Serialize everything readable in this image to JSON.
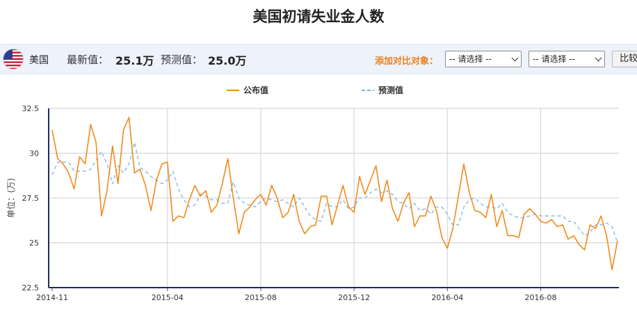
{
  "page": {
    "title": "美国初请失业金人数"
  },
  "info_bar": {
    "country": "美国",
    "latest_label": "最新值：",
    "latest_value": "25.1万",
    "forecast_label": "预测值：",
    "forecast_value": "25.0万",
    "compare_label": "添加对比对象：",
    "select1": "-- 请选择 --",
    "select2": "-- 请选择 --",
    "compare_button": "比较"
  },
  "colors": {
    "actual": "#f08a1c",
    "forecast": "#7cb4e0",
    "compare_label": "#e8801e"
  },
  "icons": {
    "flag": "us-flag-icon"
  },
  "chart_data": {
    "type": "line",
    "ylabel": "单位：(万)",
    "ylim": [
      22.5,
      32.5
    ],
    "yticks": [
      22.5,
      25,
      27.5,
      30,
      32.5
    ],
    "ytick_labels": [
      "22.5",
      "25",
      "27.5",
      "30",
      "32.5"
    ],
    "x_tick_labels": [
      "2014-11",
      "2015-04",
      "2015-08",
      "2015-12",
      "2016-04",
      "2016-08"
    ],
    "x_tick_index": [
      0,
      21,
      38,
      55,
      72,
      89
    ],
    "grid": true,
    "legend_position": "top-center",
    "series": [
      {
        "name": "公布值",
        "style": "solid",
        "values": [
          31.3,
          29.7,
          29.4,
          28.9,
          28.0,
          29.8,
          29.4,
          31.6,
          30.6,
          26.5,
          27.9,
          30.4,
          28.3,
          31.3,
          32.0,
          28.9,
          29.1,
          28.2,
          26.8,
          28.5,
          29.4,
          29.5,
          26.2,
          26.5,
          26.4,
          27.4,
          28.2,
          27.6,
          27.9,
          26.7,
          27.1,
          28.3,
          29.7,
          27.5,
          25.5,
          26.7,
          27.0,
          27.4,
          27.7,
          27.1,
          28.2,
          27.5,
          26.4,
          26.7,
          27.7,
          26.2,
          25.5,
          25.9,
          26.0,
          27.6,
          27.6,
          26.0,
          27.1,
          28.2,
          27.0,
          26.7,
          28.7,
          27.7,
          28.5,
          29.3,
          27.3,
          28.5,
          26.9,
          26.2,
          27.2,
          27.8,
          25.9,
          26.5,
          26.5,
          27.6,
          26.8,
          25.3,
          24.7,
          25.8,
          27.6,
          29.4,
          27.8,
          26.8,
          26.7,
          26.4,
          27.7,
          25.9,
          26.8,
          25.4,
          25.4,
          25.3,
          26.6,
          26.9,
          26.6,
          26.2,
          26.1,
          26.3,
          25.9,
          26.0,
          25.2,
          25.4,
          24.9,
          24.6,
          26.0,
          25.8,
          26.5,
          25.4,
          23.5,
          25.1
        ]
      },
      {
        "name": "预测值",
        "style": "dashed",
        "values": [
          28.8,
          29.5,
          29.5,
          29.5,
          29.0,
          29.0,
          29.0,
          29.1,
          29.6,
          30.1,
          29.4,
          28.3,
          29.3,
          28.9,
          29.4,
          30.6,
          29.2,
          29.0,
          28.7,
          28.5,
          28.3,
          28.5,
          29.0,
          28.0,
          27.4,
          27.0,
          27.1,
          27.7,
          27.6,
          27.4,
          27.4,
          27.2,
          27.2,
          28.4,
          27.5,
          27.2,
          27.1,
          27.0,
          27.3,
          27.5,
          27.4,
          27.3,
          27.4,
          27.2,
          27.0,
          27.5,
          27.0,
          26.5,
          26.3,
          26.2,
          27.2,
          27.0,
          27.0,
          27.4,
          26.9,
          27.0,
          27.5,
          27.5,
          27.8,
          28.0,
          27.8,
          27.9,
          27.7,
          27.3,
          27.2,
          26.9,
          27.2,
          26.8,
          26.9,
          26.6,
          27.0,
          27.0,
          26.6,
          26.0,
          26.0,
          27.0,
          27.4,
          27.5,
          27.2,
          27.0,
          27.0,
          26.9,
          27.2,
          26.7,
          26.5,
          26.4,
          26.4,
          26.5,
          26.6,
          26.5,
          26.5,
          26.5,
          26.5,
          26.5,
          26.2,
          26.2,
          25.8,
          25.4,
          25.6,
          26.0,
          26.0,
          26.1,
          25.9,
          25.0
        ]
      }
    ]
  }
}
